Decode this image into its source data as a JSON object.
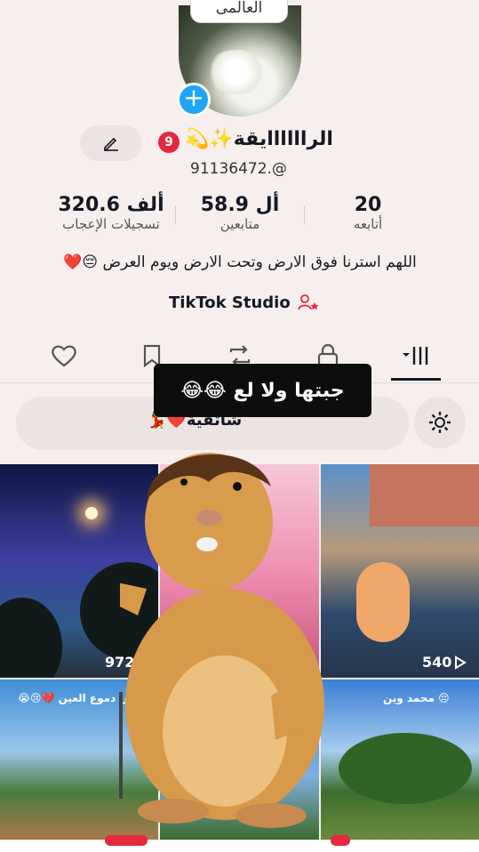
{
  "header": {
    "badge_text": "العالمى"
  },
  "profile": {
    "name": "الراااااايقة✨💫",
    "notif_count": "9",
    "handle": "91136472.@"
  },
  "stats": [
    {
      "value": "20",
      "label": "أتابعه"
    },
    {
      "value": "58.9 أل",
      "label": "متابعين"
    },
    {
      "value": "320.6 ألف",
      "label": "تسجيلات الإعجاب"
    }
  ],
  "bio": "اللهم استرنا فوق الارض وتحت الارض ويوم العرض 😔❤️",
  "studio_label": "TikTok Studio",
  "overlay_text": "جبتها ولا لع 😂😂",
  "playlist_label": "شاتقية❤️💃",
  "videos": [
    {
      "views": "972"
    },
    {
      "views": ""
    },
    {
      "views": "540"
    },
    {
      "caption": "ليش دموع العين 💔😢😭"
    },
    {
      "caption": ""
    },
    {
      "caption": "😔 محمد وين"
    }
  ],
  "colors": {
    "accent_blue": "#20a5f5",
    "badge_red": "#e5283c",
    "background": "#f6efee"
  }
}
